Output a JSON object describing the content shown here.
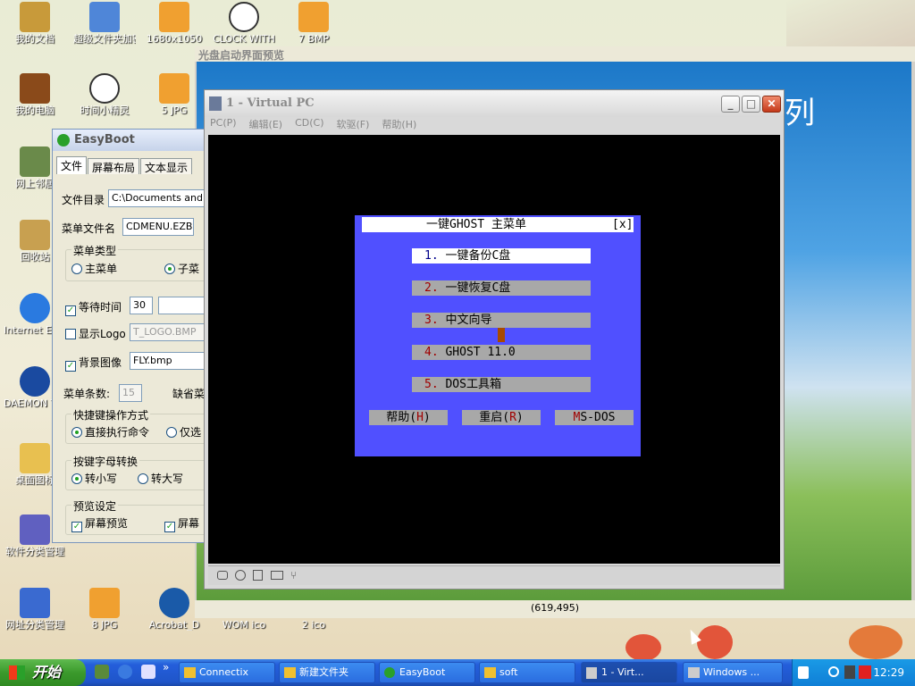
{
  "desktop": {
    "icons": [
      {
        "label": "我的文档"
      },
      {
        "label": "超级文件夹加密"
      },
      {
        "label": "1680x1050"
      },
      {
        "label": "CLOCK WITH"
      },
      {
        "label": "7 BMP"
      },
      {
        "label": "我的电脑"
      },
      {
        "label": "时间小精灵"
      },
      {
        "label": "5 JPG"
      },
      {
        "label": "网上邻居"
      },
      {
        "label": "回收站"
      },
      {
        "label": "Internet Explorer"
      },
      {
        "label": "DAEMON Tools"
      },
      {
        "label": "桌面图标"
      },
      {
        "label": "软件分类管理"
      },
      {
        "label": "网址分类管理"
      },
      {
        "label": "8 JPG"
      },
      {
        "label": "Acrobat_D"
      },
      {
        "label": "WOM ico"
      },
      {
        "label": "2 ico"
      }
    ]
  },
  "preview": {
    "title": "光盘启动界面预览",
    "side_text": "列",
    "status_coords": "(619,495)"
  },
  "easyboot": {
    "title": "EasyBoot",
    "tabs": [
      "文件",
      "屏幕布局",
      "文本显示"
    ],
    "file_dir_label": "文件目录",
    "file_dir_value": "C:\\Documents and Se",
    "menu_file_label": "菜单文件名",
    "menu_file_value": "CDMENU.EZB",
    "menu_type_group": "菜单类型",
    "menu_type_main": "主菜单",
    "menu_type_sub": "子菜",
    "wait_time_label": "等待时间",
    "wait_time_value": "30",
    "show_logo_label": "显示Logo",
    "show_logo_value": "T_LOGO.BMP",
    "bg_image_label": "背景图像",
    "bg_image_value": "FLY.bmp",
    "menu_count_label": "菜单条数:",
    "menu_count_value": "15",
    "default_menu_label": "缺省菜",
    "hotkey_group": "快捷键操作方式",
    "hotkey_exec": "直接执行命令",
    "hotkey_select": "仅选",
    "letter_group": "按键字母转换",
    "letter_lower": "转小写",
    "letter_upper": "转大写",
    "preview_group": "预览设定",
    "preview_screen": "屏幕预览",
    "preview_screen2": "屏幕"
  },
  "vpc": {
    "title": "1 - Virtual PC",
    "menu": [
      "PC(P)",
      "编辑(E)",
      "CD(C)",
      "软驱(F)",
      "帮助(H)"
    ]
  },
  "dos_menu": {
    "title": "一键GHOST 主菜单",
    "close": "[x]",
    "items": [
      {
        "num": "1.",
        "label": "一键备份C盘"
      },
      {
        "num": "2.",
        "label": "一键恢复C盘"
      },
      {
        "num": "3.",
        "label": "中文向导"
      },
      {
        "num": "4.",
        "label": "GHOST 11.0"
      },
      {
        "num": "5.",
        "label": "DOS工具箱"
      }
    ],
    "buttons": [
      {
        "pre": "帮助(",
        "key": "H",
        "post": ")"
      },
      {
        "pre": "重启(",
        "key": "R",
        "post": ")"
      },
      {
        "pre": "",
        "key": "M",
        "post": "S-DOS"
      }
    ]
  },
  "taskbar": {
    "start": "开始",
    "tasks": [
      "Connectix",
      "新建文件夹",
      "EasyBoot",
      "soft",
      "1 - Virt...",
      "Windows ..."
    ],
    "clock": "12:29"
  }
}
